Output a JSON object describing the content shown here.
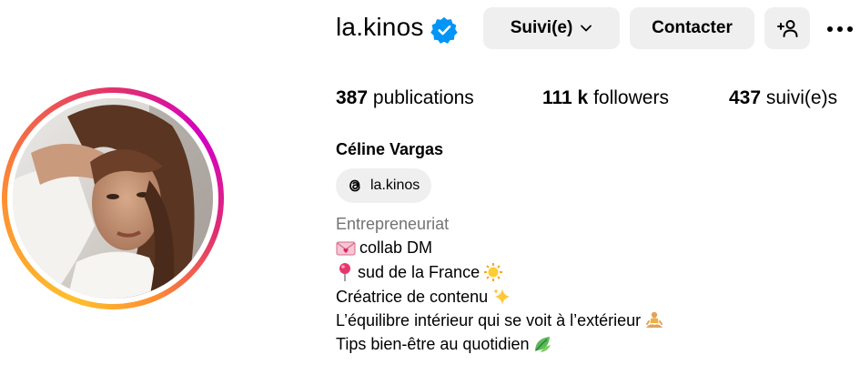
{
  "profile": {
    "username": "la.kinos",
    "full_name": "Céline Vargas",
    "verified": true
  },
  "actions": {
    "follow_label": "Suivi(e)",
    "message_label": "Contacter",
    "suggest_icon": "add-person-icon",
    "more_icon": "more-horizontal-icon"
  },
  "stats": {
    "posts_count": "387",
    "posts_label": "publications",
    "followers_count": "111 k",
    "followers_label": "followers",
    "following_count": "437",
    "following_label": "suivi(e)s"
  },
  "threads": {
    "handle": "la.kinos",
    "icon": "threads-icon"
  },
  "bio": {
    "category": "Entrepreneuriat",
    "lines": [
      {
        "text": "collab DM",
        "emoji": "love-letter-icon"
      },
      {
        "text": "sud de la France",
        "emoji": "pushpin-icon",
        "emoji_after": "sun-icon"
      },
      {
        "text": "Créatrice de contenu",
        "emoji_after": "sparkles-icon"
      },
      {
        "text": "L’équilibre intérieur qui se voit à l’extérieur",
        "emoji_after": "meditation-icon"
      },
      {
        "text": "Tips bien-être au quotidien",
        "emoji_after": "leaf-icon"
      }
    ]
  },
  "colors": {
    "button_bg": "#efefef",
    "verified_blue": "#0095f6",
    "category_gray": "#737373",
    "story_ring": [
      "#fdc02c",
      "#fd8d32",
      "#e1306c",
      "#d300c5"
    ]
  }
}
